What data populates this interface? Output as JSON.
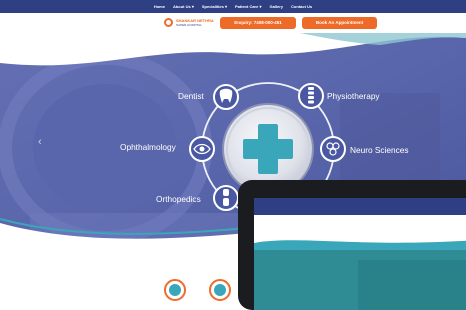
{
  "nav": {
    "items": [
      "Home",
      "About Us ▾",
      "Specialities ▾",
      "Patient Care ▾",
      "Gallery",
      "Contact Us"
    ]
  },
  "header": {
    "logo_line1": "SHANKAR NETHRA",
    "logo_line2": "SUPER HOSPITAL",
    "enquiry_label": "Enquiry: 7408-000-451",
    "appointment_label": "Book An Appointment"
  },
  "hero": {
    "services": {
      "dentist": "Dentist",
      "physiotherapy": "Physiotherapy",
      "ophthalmology": "Ophthalmology",
      "neuro": "Neuro Sciences",
      "orthopedics": "Orthopedics"
    },
    "prev_arrow": "‹"
  },
  "colors": {
    "nav_bg": "#2f3f83",
    "accent_orange": "#ee6a28",
    "hero_overlay": "#5561a8",
    "teal": "#3aa6b9"
  },
  "icons": [
    "tooth-icon",
    "spine-icon",
    "eye-icon",
    "brain-icon",
    "knee-icon",
    "medical-cross-icon"
  ]
}
